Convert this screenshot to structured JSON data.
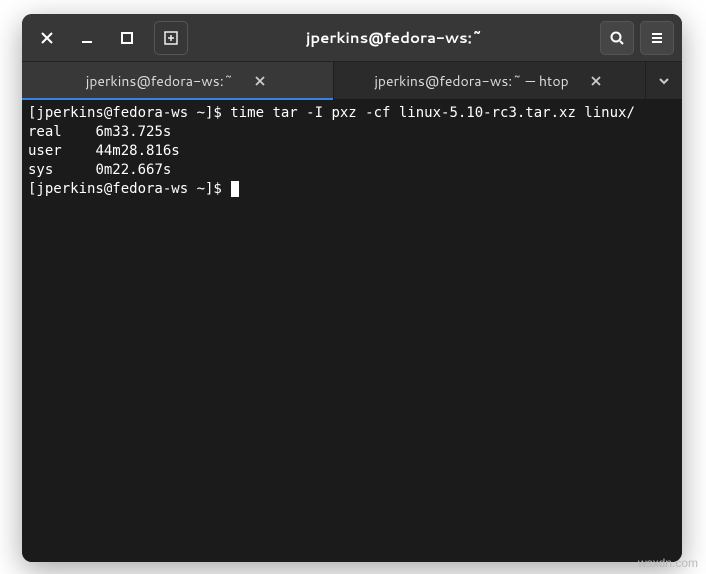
{
  "titlebar": {
    "title": "jperkins@fedora-ws:~"
  },
  "tabs": [
    {
      "label": "jperkins@fedora-ws:~",
      "active": true
    },
    {
      "label": "jperkins@fedora-ws:~ — htop",
      "active": false
    }
  ],
  "terminal": {
    "prompt1": "[jperkins@fedora-ws ~]$ ",
    "command": "time tar -I pxz -cf linux-5.10-rc3.tar.xz linux/",
    "blank": "",
    "timing": [
      {
        "label": "real",
        "value": "6m33.725s"
      },
      {
        "label": "user",
        "value": "44m28.816s"
      },
      {
        "label": "sys",
        "value": "0m22.667s"
      }
    ],
    "prompt2": "[jperkins@fedora-ws ~]$ "
  },
  "watermark": "wsxdn.com"
}
